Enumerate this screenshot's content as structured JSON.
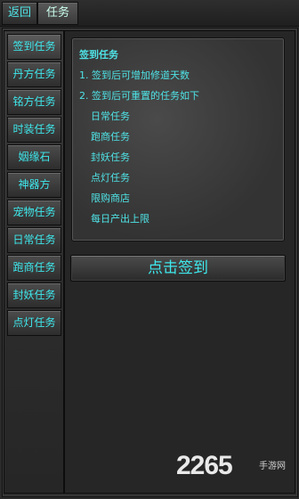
{
  "topbar": {
    "back": "返回",
    "task": "任务"
  },
  "sidebar": {
    "items": [
      "签到任务",
      "丹方任务",
      "铭方任务",
      "时装任务",
      "姻缘石",
      "神器方",
      "宠物任务",
      "日常任务",
      "跑商任务",
      "封妖任务",
      "点灯任务"
    ]
  },
  "panel": {
    "title": "签到任务",
    "line1": "1. 签到后可增加修道天数",
    "line2": "2. 签到后可重置的任务如下",
    "sub_items": [
      "日常任务",
      "跑商任务",
      "封妖任务",
      "点灯任务",
      "限购商店",
      "每日产出上限"
    ]
  },
  "sign_button": "点击签到",
  "watermark": {
    "number": "2265",
    "text": "手游网"
  },
  "colors": {
    "accent": "#4fe3e6",
    "background": "#2b2b2b"
  }
}
